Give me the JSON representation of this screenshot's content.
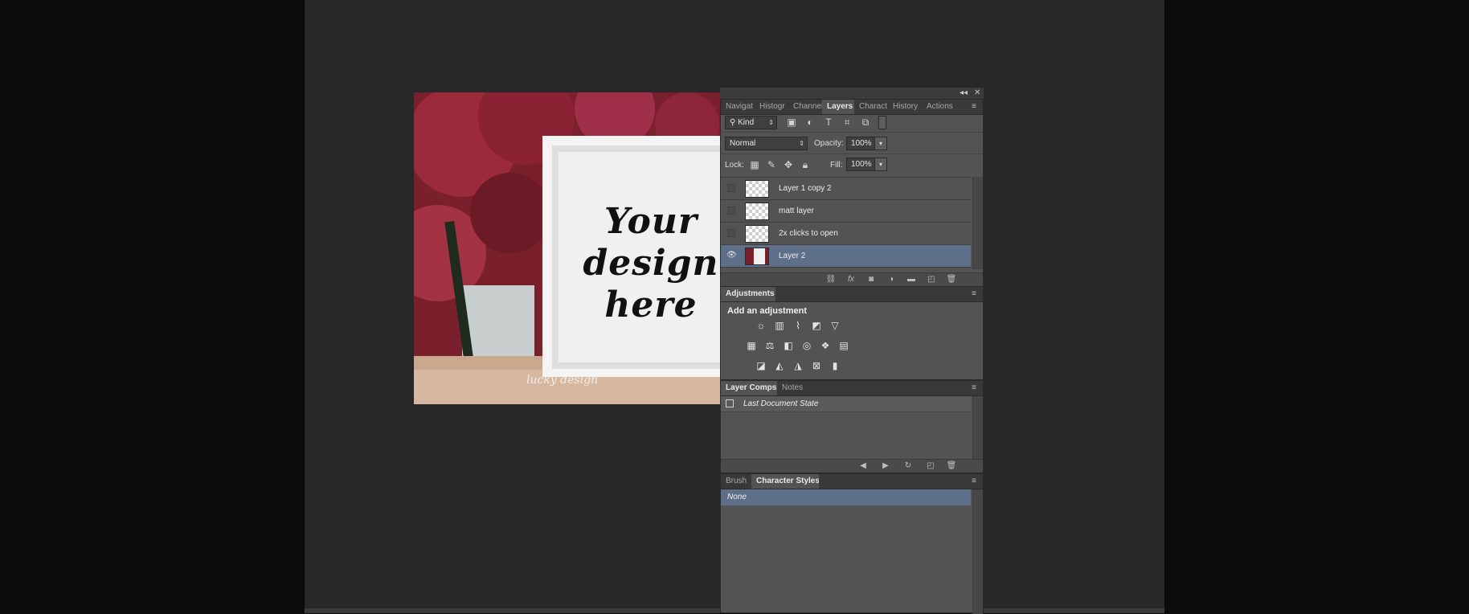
{
  "canvas": {
    "design_text_lines": [
      "Your",
      "design",
      "here"
    ],
    "watermark_text": "lucky design"
  },
  "panel_strip": {
    "collapse_label": "◂◂",
    "close_label": "✕"
  },
  "layers_panel": {
    "tabs": [
      "Navigat",
      "Histogr",
      "Channel",
      "Layers",
      "Charact",
      "History",
      "Actions"
    ],
    "active_tab": "Layers",
    "filter_kind": "Kind",
    "blend_mode": "Normal",
    "opacity_label": "Opacity:",
    "opacity_value": "100%",
    "lock_label": "Lock:",
    "fill_label": "Fill:",
    "fill_value": "100%",
    "layers": [
      {
        "name": "Layer 1 copy 2",
        "visible": false
      },
      {
        "name": "matt layer",
        "visible": false
      },
      {
        "name": "2x clicks to open",
        "visible": false
      },
      {
        "name": "Layer 2",
        "visible": true,
        "selected": true
      }
    ],
    "footer_icons": [
      "link-icon",
      "fx-icon",
      "mask-icon",
      "adjustment-layer-icon",
      "group-folder-icon",
      "new-layer-icon",
      "trash-icon"
    ]
  },
  "adjustments_panel": {
    "tab": "Adjustments",
    "heading": "Add an adjustment",
    "row1_icons": [
      "brightness-contrast-icon",
      "levels-icon",
      "curves-icon",
      "exposure-icon",
      "vibrance-icon"
    ],
    "row2_icons": [
      "hue-saturation-icon",
      "color-balance-icon",
      "black-white-icon",
      "photo-filter-icon",
      "channel-mixer-icon",
      "color-lookup-icon"
    ],
    "row3_icons": [
      "invert-icon",
      "posterize-icon",
      "threshold-icon",
      "selective-color-icon",
      "gradient-map-icon"
    ]
  },
  "layer_comps_panel": {
    "tabs": [
      "Layer Comps",
      "Notes"
    ],
    "active_tab": "Layer Comps",
    "rows": [
      "Last Document State"
    ]
  },
  "brush_panel": {
    "tabs": [
      "Brush",
      "Character Styles"
    ],
    "active_tab": "Character Styles",
    "rows": [
      "None"
    ]
  }
}
